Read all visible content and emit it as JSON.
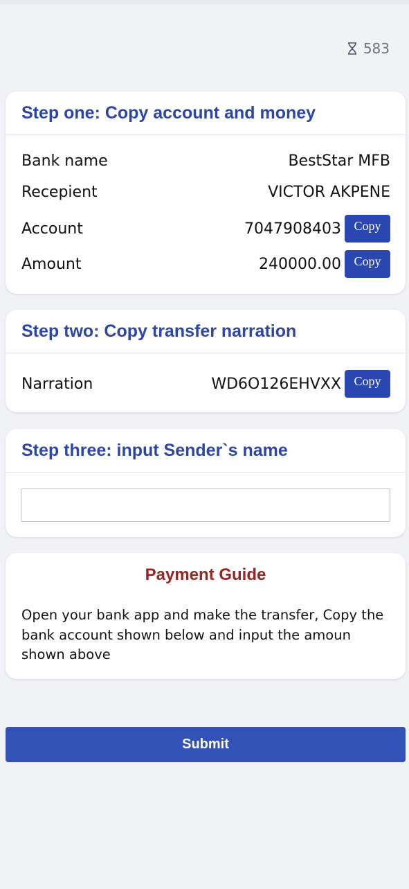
{
  "timer": {
    "icon": "hourglass-icon",
    "value": "583"
  },
  "step_one": {
    "title": "Step one: Copy account and money",
    "rows": [
      {
        "label": "Bank name",
        "value": "BestStar MFB"
      },
      {
        "label": "Recepient",
        "value": "VICTOR AKPENE"
      },
      {
        "label": "Account",
        "value": "7047908403",
        "button": "Copy"
      },
      {
        "label": "Amount",
        "value": "240000.00",
        "button": "Copy"
      }
    ]
  },
  "step_two": {
    "title": "Step two: Copy transfer narration",
    "row": {
      "label": "Narration",
      "value": "WD6O126EHVXX",
      "button": "Copy"
    }
  },
  "step_three": {
    "title": "Step three: input Sender`s name",
    "input": {
      "value": "",
      "placeholder": ""
    }
  },
  "guide": {
    "title": "Payment Guide",
    "text": "Open your bank app and make the transfer, Copy the bank account shown below and input the amoun shown above"
  },
  "submit": {
    "label": "Submit"
  },
  "colors": {
    "accent": "#2c45a8",
    "button": "#2b47b2",
    "guide_title": "#962624",
    "submit": "#3252b7"
  }
}
